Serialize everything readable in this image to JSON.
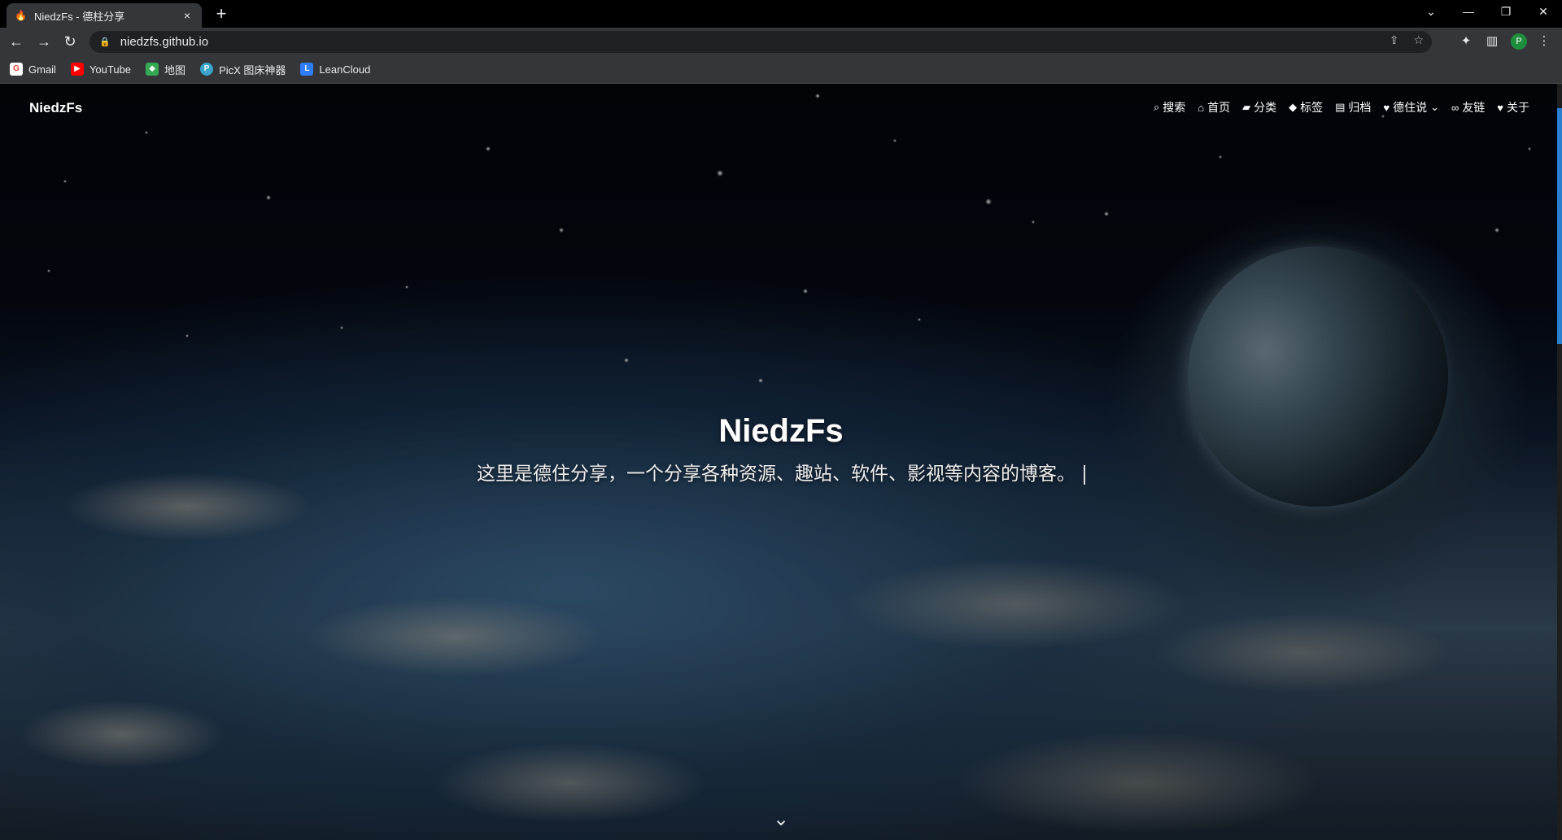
{
  "browser": {
    "tab_title": "NiedzFs - 德柱分享",
    "tab_close": "×",
    "new_tab": "+",
    "url": "niedzfs.github.io",
    "profile_initial": "P",
    "bookmarks": [
      {
        "label": "Gmail",
        "icon": "google-icon",
        "color": "#ea4335"
      },
      {
        "label": "YouTube",
        "icon": "youtube-icon",
        "color": "#ff0000"
      },
      {
        "label": "地图",
        "icon": "maps-icon",
        "color": "#34a853"
      },
      {
        "label": "PicX 图床神器",
        "icon": "picx-icon",
        "color": "#3aa3c9"
      },
      {
        "label": "LeanCloud",
        "icon": "leancloud-icon",
        "color": "#2e7cf6"
      }
    ]
  },
  "site": {
    "brand": "NiedzFs",
    "title": "NiedzFs",
    "subtitle": "这里是德住分享，一个分享各种资源、趣站、软件、影视等内容的博客。",
    "menu": [
      {
        "label": "搜索",
        "icon": "search-icon"
      },
      {
        "label": "首页",
        "icon": "home-icon"
      },
      {
        "label": "分类",
        "icon": "folder-icon"
      },
      {
        "label": "标签",
        "icon": "tags-icon"
      },
      {
        "label": "归档",
        "icon": "archive-icon"
      },
      {
        "label": "德住说",
        "icon": "heart-icon"
      },
      {
        "label": "友链",
        "icon": "link-icon"
      },
      {
        "label": "关于",
        "icon": "heart-icon"
      }
    ]
  },
  "colors": {
    "chrome_bg": "#202124",
    "toolbar_bg": "#35363a",
    "accent_scroll": "#2a7fd0"
  }
}
